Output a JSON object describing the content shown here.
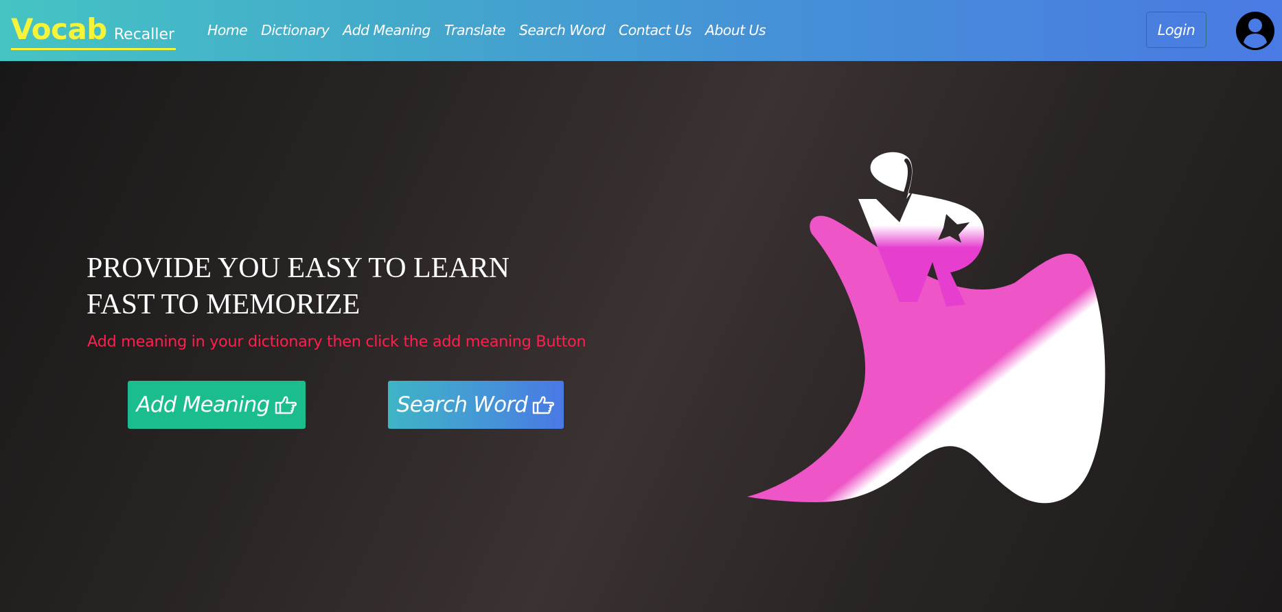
{
  "brand": {
    "main": "Vocab",
    "sub": "Recaller"
  },
  "nav": {
    "items": [
      {
        "label": "Home"
      },
      {
        "label": "Dictionary"
      },
      {
        "label": "Add Meaning"
      },
      {
        "label": "Translate"
      },
      {
        "label": "Search Word"
      },
      {
        "label": "Contact Us"
      },
      {
        "label": "About Us"
      }
    ],
    "login_label": "Login"
  },
  "hero": {
    "title_line1": "PROVIDE YOU EASY TO LEARN",
    "title_line2": "FAST TO MEMORIZE",
    "subtitle": "Add meaning in your dictionary then click the add meaning Button",
    "add_button_label": "Add Meaning",
    "search_button_label": "Search Word"
  },
  "icons": {
    "avatar": "user-circle-icon",
    "button_icon": "hand-pointing-right-icon",
    "logo": "vr-logo"
  },
  "colors": {
    "brand_yellow": "#f5f43a",
    "subtitle_red": "#ff1e4e",
    "add_button": "#1bbd8f",
    "logo_pink": "#ee55c6"
  }
}
